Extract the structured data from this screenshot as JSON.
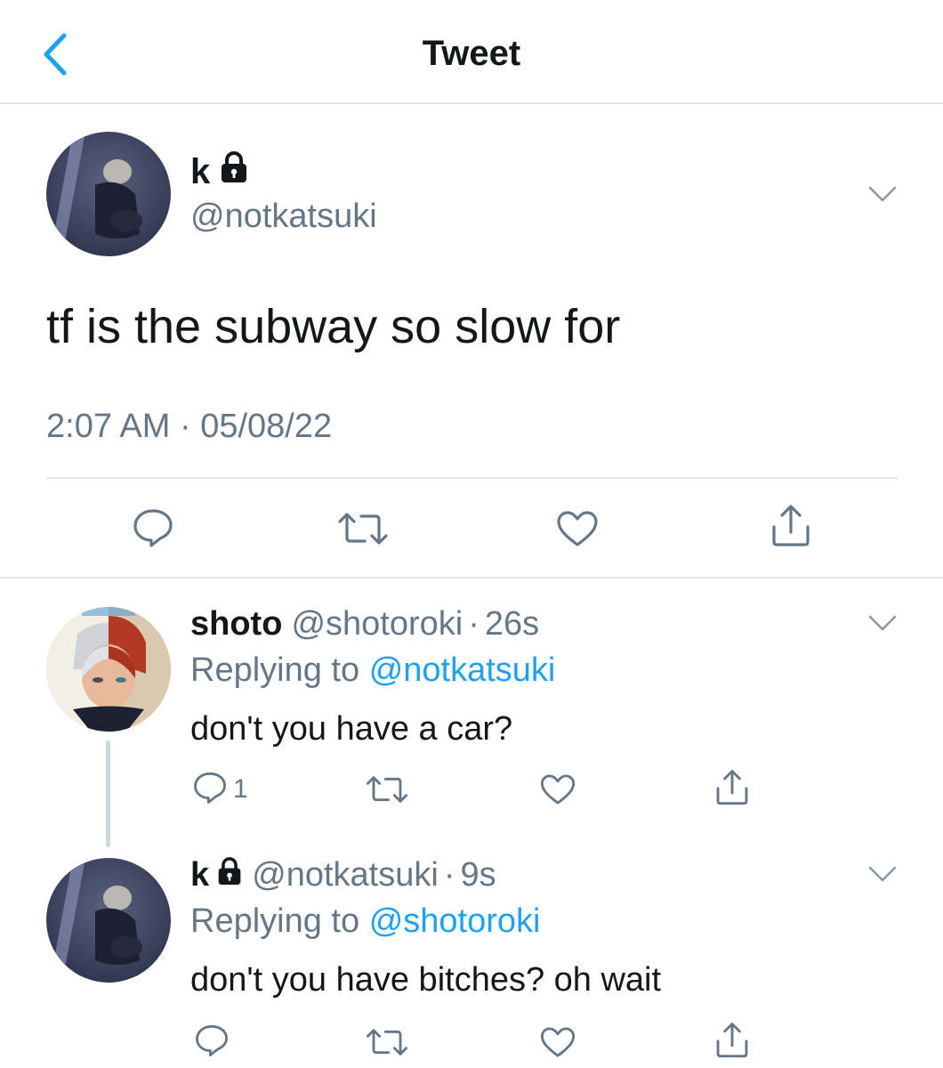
{
  "header": {
    "title": "Tweet"
  },
  "tweet": {
    "name": "k",
    "handle": "@notkatsuki",
    "text": "tf is the subway so slow for",
    "timestamp": "2:07 AM · 05/08/22"
  },
  "replies": [
    {
      "name": "shoto",
      "handle": "@shotoroki",
      "time": "26s",
      "replying_label": "Replying to",
      "replying_to": "@notkatsuki",
      "text": "don't you have a car?",
      "reply_count": "1"
    },
    {
      "name": "k",
      "handle": "@notkatsuki",
      "time": "9s",
      "replying_label": "Replying to",
      "replying_to": "@shotoroki",
      "text": "don't you have bitches? oh wait"
    }
  ],
  "sep": "·",
  "colors": {
    "accent": "#1da1f2",
    "secondary_text": "#657786",
    "icon": "#657786"
  },
  "icons": [
    "back-chevron",
    "lock",
    "chevron-down",
    "reply",
    "retweet",
    "like",
    "share"
  ]
}
